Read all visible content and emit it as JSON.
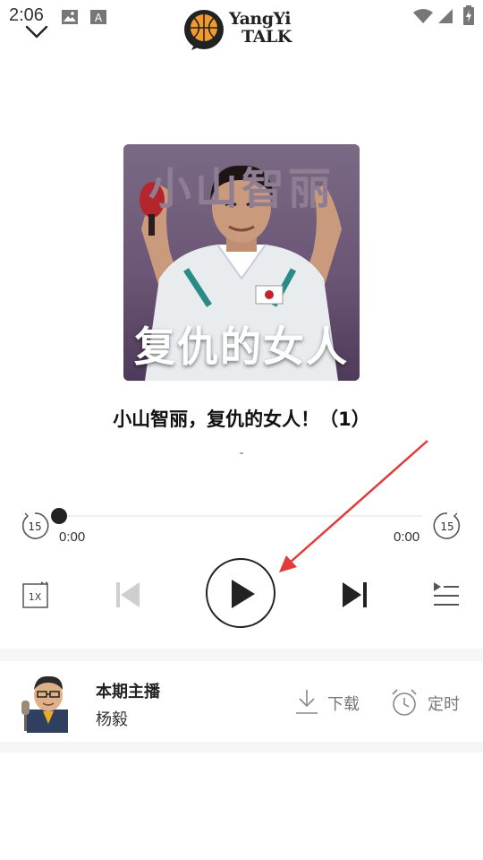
{
  "status_bar": {
    "time": "2:06"
  },
  "header": {
    "logo_line1": "YangYi",
    "logo_line2": "TALK"
  },
  "cover": {
    "top_text": "小山智丽",
    "bottom_text": "复仇的女人"
  },
  "episode": {
    "title": "小山智丽，复仇的女人！（1）",
    "subtitle": "-"
  },
  "player": {
    "current_time": "0:00",
    "total_time": "0:00",
    "progress": 0,
    "rewind_seconds": "15",
    "forward_seconds": "15",
    "speed": "1X"
  },
  "host": {
    "title": "本期主播",
    "name": "杨毅"
  },
  "actions": {
    "download": "下载",
    "timer": "定时"
  },
  "colors": {
    "accent_dark": "#222222",
    "logo_orange": "#f29a2e",
    "logo_yellow": "#f5b400",
    "muted": "#777777"
  }
}
